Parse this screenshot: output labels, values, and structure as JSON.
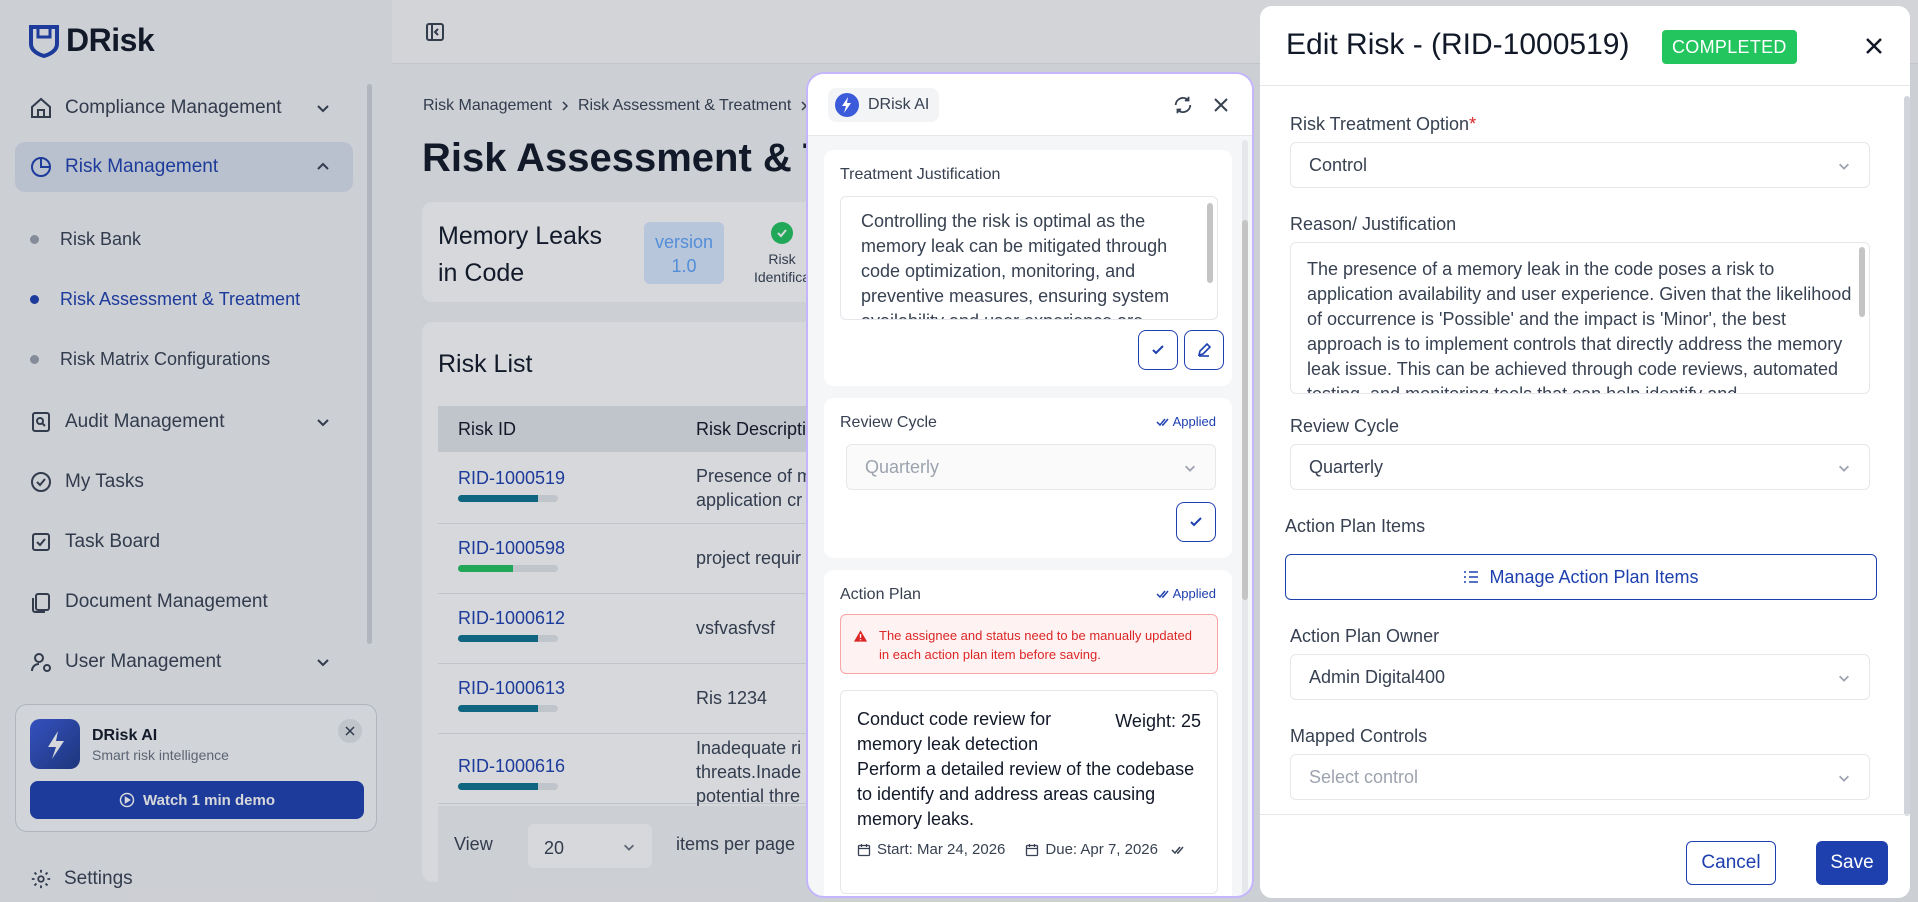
{
  "app": {
    "name": "DRisk"
  },
  "sidebar": {
    "items": [
      {
        "label": "Compliance Management"
      },
      {
        "label": "Risk Management"
      },
      {
        "label": "Audit Management"
      },
      {
        "label": "My Tasks"
      },
      {
        "label": "Task Board"
      },
      {
        "label": "Document Management"
      },
      {
        "label": "User Management"
      }
    ],
    "sub_items": [
      {
        "label": "Risk Bank"
      },
      {
        "label": "Risk Assessment & Treatment"
      },
      {
        "label": "Risk Matrix Configurations"
      }
    ],
    "promo": {
      "title": "DRisk AI",
      "subtitle": "Smart risk intelligence",
      "button": "Watch 1 min demo"
    },
    "settings": "Settings"
  },
  "main": {
    "breadcrumb": [
      "Risk Management",
      "Risk Assessment & Treatment"
    ],
    "title": "Risk Assessment & Tr",
    "risk_name": "Memory Leaks in Code",
    "version": "version 1.0",
    "step_label": "Risk Identifica",
    "list_title": "Risk List",
    "columns": [
      "Risk ID",
      "Risk Descripti"
    ],
    "rows": [
      {
        "id": "RID-1000519",
        "desc": "Presence of m",
        "desc2": "application cr",
        "progress": 0.8,
        "color": "#0e7490"
      },
      {
        "id": "RID-1000598",
        "desc": "project requir",
        "desc2": "",
        "progress": 0.55,
        "color": "#22c55e"
      },
      {
        "id": "RID-1000612",
        "desc": "vsfvasfvsf",
        "desc2": "",
        "progress": 0.8,
        "color": "#0e7490"
      },
      {
        "id": "RID-1000613",
        "desc": "Ris 1234",
        "desc2": "",
        "progress": 0.8,
        "color": "#0e7490"
      },
      {
        "id": "RID-1000616",
        "desc": "Inadequate ri",
        "desc2": "threats.Inade",
        "desc3": "potential thre",
        "progress": 0.8,
        "color": "#0e7490"
      }
    ],
    "pager": {
      "view": "View",
      "size": "20",
      "suffix": "items per page"
    }
  },
  "ai_panel": {
    "title": "DRisk AI",
    "treatment": {
      "label": "Treatment Justification",
      "text": "Controlling the risk is optimal as the memory leak can be mitigated through code optimization, monitoring, and preventive measures, ensuring system availability and user experience are"
    },
    "review": {
      "label": "Review Cycle",
      "applied": "Applied",
      "value": "Quarterly"
    },
    "action_plan": {
      "label": "Action Plan",
      "applied": "Applied",
      "warning": "The assignee and status need to be manually updated in each action plan item before saving.",
      "item": {
        "title": "Conduct code review for memory leak detection",
        "weight": "Weight: 25",
        "description": "Perform a detailed review of the codebase to identify and address areas causing memory leaks.",
        "start": "Start: Mar 24, 2026",
        "due": "Due: Apr 7, 2026"
      }
    }
  },
  "edit_panel": {
    "title": "Edit Risk - (RID-1000519)",
    "status": "COMPLETED",
    "treatment_label": "Risk Treatment Option",
    "required_mark": "*",
    "treatment_value": "Control",
    "reason_label": "Reason/ Justification",
    "reason_text": "The presence of a memory leak in the code poses a risk to application availability and user experience. Given that the likelihood of occurrence is 'Possible' and the impact is 'Minor', the best approach is to implement controls that directly address the memory leak issue. This can be achieved through code reviews, automated testing, and monitoring tools that can help identify and",
    "review_label": "Review Cycle",
    "review_value": "Quarterly",
    "action_items_label": "Action Plan Items",
    "manage_button": "Manage Action Plan Items",
    "owner_label": "Action Plan Owner",
    "owner_value": "Admin Digital400",
    "controls_label": "Mapped Controls",
    "controls_placeholder": "Select control",
    "cancel": "Cancel",
    "save": "Save"
  },
  "colors": {
    "accent": "#1e40af",
    "success": "#22c55e",
    "error": "#dc2626"
  }
}
